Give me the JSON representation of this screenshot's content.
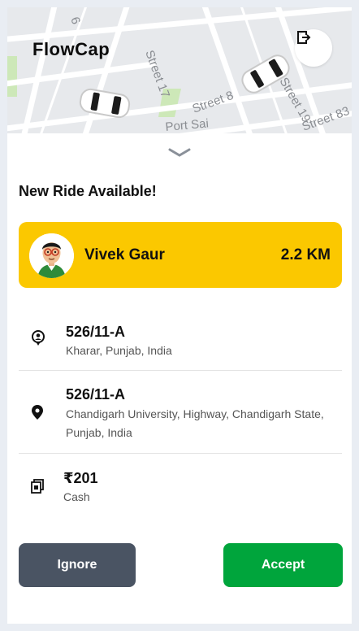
{
  "app": {
    "brand": "FlowCap"
  },
  "map": {
    "street_labels": [
      "Street 17",
      "Street 8",
      "Street 19",
      "Street 83",
      "Port Sai",
      "6"
    ]
  },
  "header": {
    "logout_icon": "logout-icon"
  },
  "ride_request": {
    "heading": "New Ride Available!",
    "rider": {
      "name": "Vivek Gaur",
      "distance": "2.2 KM"
    },
    "pickup": {
      "title": "526/11-A",
      "address": "Kharar, Punjab, India"
    },
    "dropoff": {
      "title": "526/11-A",
      "address": "Chandigarh University, Highway, Chandigarh State, Punjab, India"
    },
    "fare": {
      "amount": "₹201",
      "method": "Cash"
    }
  },
  "actions": {
    "ignore_label": "Ignore",
    "accept_label": "Accept"
  },
  "colors": {
    "rider_card": "#fbc800",
    "accept": "#00a53c",
    "ignore": "#4a5463"
  }
}
